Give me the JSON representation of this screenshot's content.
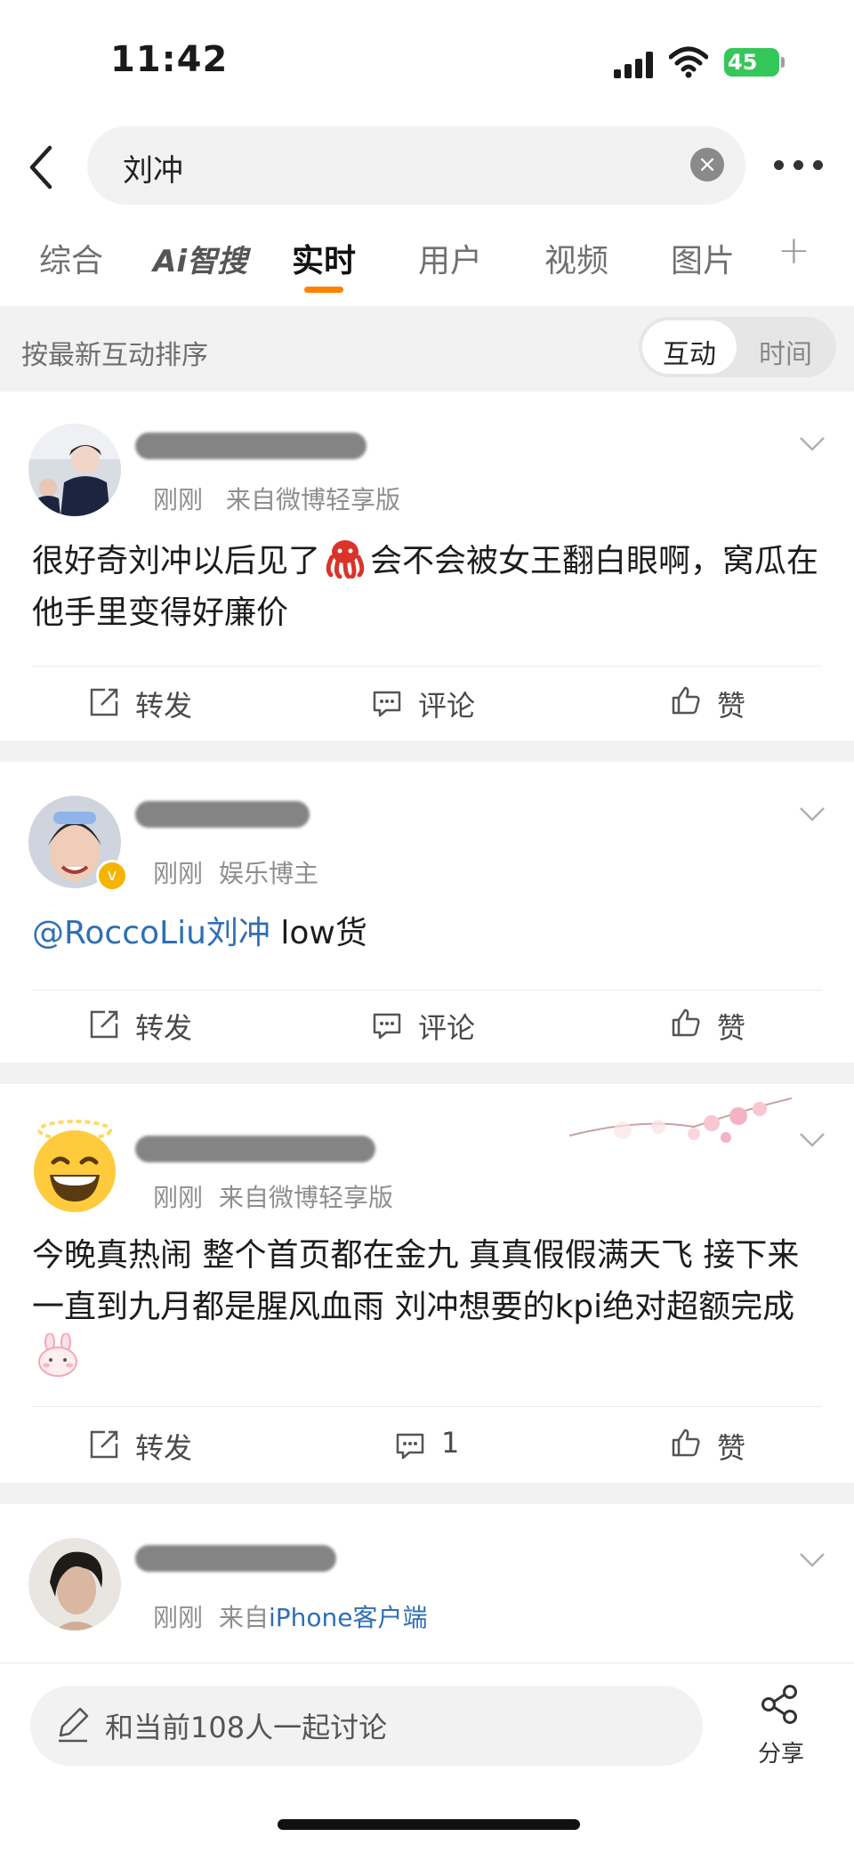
{
  "status_bar": {
    "time": "11:42",
    "battery": "45"
  },
  "search": {
    "query": "刘冲"
  },
  "tabs": [
    {
      "label": "综合",
      "active": false
    },
    {
      "label": "Ai智搜",
      "active": false
    },
    {
      "label": "实时",
      "active": true
    },
    {
      "label": "用户",
      "active": false
    },
    {
      "label": "视频",
      "active": false
    },
    {
      "label": "图片",
      "active": false
    }
  ],
  "sort_bar": {
    "label": "按最新互动排序",
    "options": [
      "互动",
      "时间"
    ],
    "selected": "互动"
  },
  "posts": [
    {
      "time": "刚刚",
      "source": "来自微博轻享版",
      "text_a": "很好奇刘冲以后见了",
      "text_b": "会不会被女王翻白眼啊，窝瓜在他手里变得好廉价",
      "actions": {
        "repost": "转发",
        "comment": "评论",
        "like": "赞"
      }
    },
    {
      "time": "刚刚",
      "source": "娱乐博主",
      "mention": "@RoccoLiu刘冲",
      "text": " low货",
      "actions": {
        "repost": "转发",
        "comment": "评论",
        "like": "赞"
      }
    },
    {
      "time": "刚刚",
      "source": "来自微博轻享版",
      "text": "今晚真热闹 整个首页都在金九 真真假假满天飞 接下来一直到九月都是腥风血雨 刘冲想要的kpi绝对超额完成",
      "actions": {
        "repost": "转发",
        "comment": "1",
        "like": "赞"
      }
    },
    {
      "time": "刚刚",
      "source_prefix": "来自",
      "source_link": "iPhone客户端"
    }
  ],
  "bottom_bar": {
    "input_placeholder": "和当前108人一起讨论",
    "share_label": "分享"
  },
  "colors": {
    "accent": "#ff8200",
    "link": "#2f6fb5",
    "verified": "#f5b400"
  }
}
